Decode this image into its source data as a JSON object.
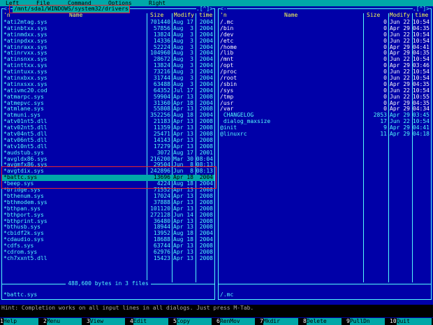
{
  "menubar": {
    "items": [
      "Left",
      "File",
      "Command",
      "Options",
      "Right"
    ]
  },
  "left_panel": {
    "path": "/mnt/sda1/WINDOWS/system32/drivers",
    "corner_left": "<-",
    "corner_right": ".[^]>",
    "headers": {
      "n": "'n",
      "name": "Name",
      "size": "Size",
      "modify": "Modify",
      "time": "time"
    },
    "rows": [
      {
        "name": "*ati2mtag.sys",
        "size": "701440",
        "month": "Aug",
        "day": "17",
        "time": "2004",
        "kind": "file"
      },
      {
        "name": "*atinbtxx.sys",
        "size": "57856",
        "month": "Aug",
        "day": "3",
        "time": "2004",
        "kind": "file"
      },
      {
        "name": "*atinmdxx.sys",
        "size": "13824",
        "month": "Aug",
        "day": "3",
        "time": "2004",
        "kind": "file"
      },
      {
        "name": "*atinpdxx.sys",
        "size": "14336",
        "month": "Aug",
        "day": "3",
        "time": "2004",
        "kind": "file"
      },
      {
        "name": "*atinraxx.sys",
        "size": "52224",
        "month": "Aug",
        "day": "3",
        "time": "2004",
        "kind": "file"
      },
      {
        "name": "*atinrvxx.sys",
        "size": "104960",
        "month": "Aug",
        "day": "3",
        "time": "2004",
        "kind": "file"
      },
      {
        "name": "*atinsnxx.sys",
        "size": "28672",
        "month": "Aug",
        "day": "3",
        "time": "2004",
        "kind": "file"
      },
      {
        "name": "*atinttxx.sys",
        "size": "13824",
        "month": "Aug",
        "day": "3",
        "time": "2004",
        "kind": "file"
      },
      {
        "name": "*atintuxx.sys",
        "size": "73216",
        "month": "Aug",
        "day": "3",
        "time": "2004",
        "kind": "file"
      },
      {
        "name": "*atinxbxx.sys",
        "size": "31744",
        "month": "Aug",
        "day": "3",
        "time": "2004",
        "kind": "file"
      },
      {
        "name": "*atinxsxx.sys",
        "size": "63488",
        "month": "Aug",
        "day": "3",
        "time": "2004",
        "kind": "file"
      },
      {
        "name": "*ativmc20.cod",
        "size": "64352",
        "month": "Jul",
        "day": "17",
        "time": "2004",
        "kind": "file"
      },
      {
        "name": "*atmarpc.sys",
        "size": "59904",
        "month": "Apr",
        "day": "13",
        "time": "2008",
        "kind": "file"
      },
      {
        "name": "*atmepvc.sys",
        "size": "31360",
        "month": "Apr",
        "day": "18",
        "time": "2004",
        "kind": "file"
      },
      {
        "name": "*atmlane.sys",
        "size": "55808",
        "month": "Apr",
        "day": "13",
        "time": "2008",
        "kind": "file"
      },
      {
        "name": "*atmuni.sys",
        "size": "352256",
        "month": "Aug",
        "day": "18",
        "time": "2004",
        "kind": "file"
      },
      {
        "name": "*atv01nt5.dll",
        "size": "21183",
        "month": "Apr",
        "day": "13",
        "time": "2008",
        "kind": "file"
      },
      {
        "name": "*atv02nt5.dll",
        "size": "11359",
        "month": "Apr",
        "day": "13",
        "time": "2008",
        "kind": "file"
      },
      {
        "name": "*atv04nt5.dll",
        "size": "25471",
        "month": "Apr",
        "day": "13",
        "time": "2008",
        "kind": "file"
      },
      {
        "name": "*atv06nt5.dll",
        "size": "14143",
        "month": "Apr",
        "day": "13",
        "time": "2008",
        "kind": "file"
      },
      {
        "name": "*atv10nt5.dll",
        "size": "17279",
        "month": "Apr",
        "day": "13",
        "time": "2008",
        "kind": "file"
      },
      {
        "name": "*audstub.sys",
        "size": "3072",
        "month": "Aug",
        "day": "17",
        "time": "2001",
        "kind": "file"
      },
      {
        "name": "*avgldx86.sys",
        "size": "216200",
        "month": "Mar",
        "day": "30",
        "time": "08:04",
        "kind": "file"
      },
      {
        "name": "*avgmfx86.sys",
        "size": "29504",
        "month": "Jun",
        "day": "8",
        "time": "08:13",
        "kind": "file"
      },
      {
        "name": "*avgtdix.sys",
        "size": "242896",
        "month": "Jun",
        "day": "8",
        "time": "08:13",
        "kind": "file"
      },
      {
        "name": "*battc.sys",
        "size": "13696",
        "month": "Apr",
        "day": "18",
        "time": "2004",
        "kind": "sel"
      },
      {
        "name": "*beep.sys",
        "size": "4224",
        "month": "Aug",
        "day": "18",
        "time": "2004",
        "kind": "file"
      },
      {
        "name": "*bridge.sys",
        "size": "71552",
        "month": "Apr",
        "day": "13",
        "time": "2008",
        "kind": "file"
      },
      {
        "name": "*bthenum.sys",
        "size": "17024",
        "month": "Apr",
        "day": "13",
        "time": "2008",
        "kind": "file"
      },
      {
        "name": "*bthmodem.sys",
        "size": "37888",
        "month": "Apr",
        "day": "13",
        "time": "2008",
        "kind": "file"
      },
      {
        "name": "*bthpan.sys",
        "size": "101120",
        "month": "Apr",
        "day": "13",
        "time": "2008",
        "kind": "file"
      },
      {
        "name": "*bthport.sys",
        "size": "272128",
        "month": "Jun",
        "day": "14",
        "time": "2008",
        "kind": "file"
      },
      {
        "name": "*bthprint.sys",
        "size": "36480",
        "month": "Apr",
        "day": "13",
        "time": "2008",
        "kind": "file"
      },
      {
        "name": "*bthusb.sys",
        "size": "18944",
        "month": "Apr",
        "day": "13",
        "time": "2008",
        "kind": "file"
      },
      {
        "name": "*cbidf2k.sys",
        "size": "13952",
        "month": "Aug",
        "day": "18",
        "time": "2004",
        "kind": "file"
      },
      {
        "name": "*cdaudio.sys",
        "size": "18688",
        "month": "Aug",
        "day": "18",
        "time": "2004",
        "kind": "file"
      },
      {
        "name": "*cdfs.sys",
        "size": "63744",
        "month": "Apr",
        "day": "13",
        "time": "2008",
        "kind": "file"
      },
      {
        "name": "*cdrom.sys",
        "size": "62976",
        "month": "Apr",
        "day": "13",
        "time": "2008",
        "kind": "file"
      },
      {
        "name": "*ch7xxnt5.dll",
        "size": "15423",
        "month": "Apr",
        "day": "13",
        "time": "2008",
        "kind": "file"
      }
    ],
    "summary": "488,600 bytes in 3 files",
    "status_name": "*battc.sys"
  },
  "right_panel": {
    "corner_left": "<-",
    "corner_right": ".[^]>",
    "headers": {
      "n": "'n",
      "name": "Name",
      "size": "Size",
      "modify": "Modify",
      "time": "time"
    },
    "rows": [
      {
        "name": "/.mc",
        "size": "0",
        "month": "Jun",
        "day": "22",
        "time": "10:54",
        "kind": "dir"
      },
      {
        "name": "/bin",
        "size": "0",
        "month": "Apr",
        "day": "29",
        "time": "04:35",
        "kind": "dir"
      },
      {
        "name": "/dev",
        "size": "0",
        "month": "Jun",
        "day": "22",
        "time": "10:54",
        "kind": "dir"
      },
      {
        "name": "/etc",
        "size": "0",
        "month": "Jun",
        "day": "22",
        "time": "10:54",
        "kind": "dir"
      },
      {
        "name": "/home",
        "size": "0",
        "month": "Apr",
        "day": "29",
        "time": "04:41",
        "kind": "dir"
      },
      {
        "name": "/lib",
        "size": "0",
        "month": "Apr",
        "day": "29",
        "time": "04:35",
        "kind": "dir"
      },
      {
        "name": "/mnt",
        "size": "0",
        "month": "Jun",
        "day": "22",
        "time": "10:54",
        "kind": "dir"
      },
      {
        "name": "/opt",
        "size": "0",
        "month": "Apr",
        "day": "29",
        "time": "03:46",
        "kind": "dir"
      },
      {
        "name": "/proc",
        "size": "0",
        "month": "Jun",
        "day": "22",
        "time": "10:54",
        "kind": "dir"
      },
      {
        "name": "/root",
        "size": "0",
        "month": "Jun",
        "day": "22",
        "time": "10:54",
        "kind": "dir"
      },
      {
        "name": "/sbin",
        "size": "0",
        "month": "Apr",
        "day": "29",
        "time": "04:35",
        "kind": "dir"
      },
      {
        "name": "/sys",
        "size": "0",
        "month": "Jun",
        "day": "22",
        "time": "10:54",
        "kind": "dir"
      },
      {
        "name": "/tmp",
        "size": "0",
        "month": "Jun",
        "day": "22",
        "time": "10:55",
        "kind": "dir"
      },
      {
        "name": "/usr",
        "size": "0",
        "month": "Apr",
        "day": "29",
        "time": "04:35",
        "kind": "dir"
      },
      {
        "name": "/var",
        "size": "0",
        "month": "Apr",
        "day": "29",
        "time": "04:34",
        "kind": "dir"
      },
      {
        "name": " CHANGELOG",
        "size": "2853",
        "month": "Apr",
        "day": "29",
        "time": "03:45",
        "kind": "file"
      },
      {
        "name": " dialog_maxsize",
        "size": "17",
        "month": "Jun",
        "day": "22",
        "time": "10:54",
        "kind": "file"
      },
      {
        "name": "@init",
        "size": "9",
        "month": "Apr",
        "day": "29",
        "time": "04:41",
        "kind": "file"
      },
      {
        "name": "@linuxrc",
        "size": "11",
        "month": "Apr",
        "day": "29",
        "time": "04:18",
        "kind": "file"
      }
    ],
    "status_name": "/.mc"
  },
  "hint": "Hint: Completion works on all input lines in all dialogs. Just press M-Tab.",
  "fkeys": [
    {
      "num": "1",
      "label": "Help"
    },
    {
      "num": "2",
      "label": "Menu"
    },
    {
      "num": "3",
      "label": "View"
    },
    {
      "num": "4",
      "label": "Edit"
    },
    {
      "num": "5",
      "label": "Copy"
    },
    {
      "num": "6",
      "label": "RenMov"
    },
    {
      "num": "7",
      "label": "Mkdir"
    },
    {
      "num": "8",
      "label": "Delete"
    },
    {
      "num": "9",
      "label": "PullDn"
    },
    {
      "num": "10",
      "label": "Quit"
    }
  ]
}
